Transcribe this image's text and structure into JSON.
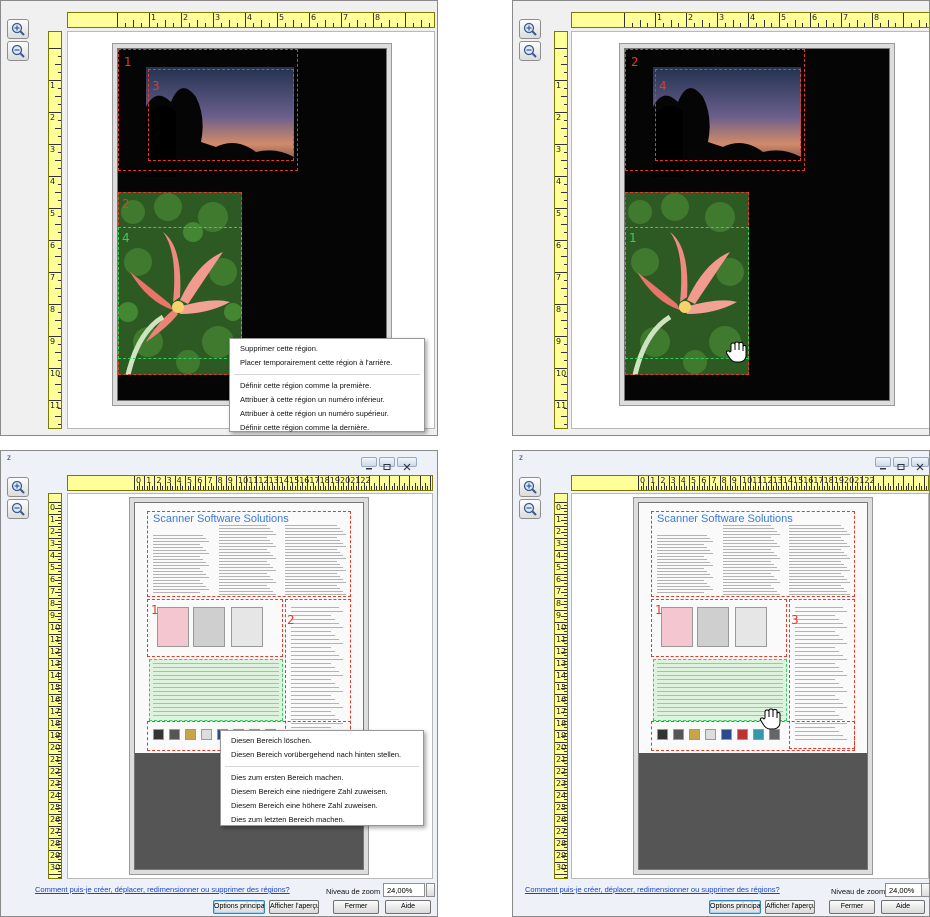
{
  "top_ruler_numbers": [
    "1",
    "2",
    "3",
    "4",
    "5",
    "6",
    "7",
    "8"
  ],
  "bottom_ruler_numbers": [
    "0",
    "1",
    "2",
    "3",
    "4",
    "5",
    "6",
    "7",
    "8",
    "9",
    "10",
    "11",
    "12",
    "13",
    "14",
    "15",
    "16",
    "17",
    "18",
    "19",
    "20",
    "21",
    "22"
  ],
  "top_vruler_numbers": [
    "1",
    "2",
    "3",
    "4",
    "5",
    "6",
    "7",
    "8",
    "9",
    "10",
    "11"
  ],
  "bottom_vruler_numbers": [
    "0",
    "1",
    "2",
    "3",
    "4",
    "5",
    "6",
    "7",
    "8",
    "9",
    "10",
    "11",
    "12",
    "13",
    "14",
    "15",
    "16",
    "17",
    "18",
    "19",
    "20",
    "21",
    "22",
    "23",
    "24",
    "25",
    "26",
    "27",
    "28",
    "29",
    "30"
  ],
  "panel_tl": {
    "region_labels": {
      "r1": "1",
      "r3": "3",
      "r2": "2",
      "r4": "4"
    },
    "context_menu": [
      "Supprimer cette région.",
      "Placer temporairement cette région à l'arrière.",
      "Définir cette région comme la première.",
      "Attribuer à cette région un numéro inférieur.",
      "Attribuer à cette région un numéro supérieur.",
      "Définir cette région comme la dernière."
    ]
  },
  "panel_tr": {
    "region_labels": {
      "r2": "2",
      "r4": "4",
      "r1": "1"
    }
  },
  "panel_bl": {
    "window_title": "z",
    "doc_title": "Scanner Software Solutions",
    "region_labels": {
      "r1": "1",
      "r2": "2"
    },
    "context_menu": [
      "Diesen Bereich löschen.",
      "Diesen Bereich vorübergehend nach hinten stellen.",
      "Dies zum ersten Bereich machen.",
      "Diesem Bereich eine niedrigere Zahl zuweisen.",
      "Diesem Bereich eine höhere Zahl zuweisen.",
      "Dies zum letzten Bereich machen."
    ],
    "help_link": "Comment puis-je créer, déplacer, redimensionner ou supprimer des régions?",
    "zoom_label": "Niveau de zoom :",
    "zoom_value": "24,00%",
    "buttons": [
      "Options principal",
      "Afficher l'aperçu",
      "Fermer",
      "Aide"
    ]
  },
  "panel_br": {
    "window_title": "z",
    "doc_title": "Scanner Software Solutions",
    "region_labels": {
      "r1": "1",
      "r3": "3"
    },
    "help_link": "Comment puis-je créer, déplacer, redimensionner ou supprimer des régions?",
    "zoom_label": "Niveau de zoom :",
    "zoom_value": "24,00%",
    "buttons": [
      "Options principal",
      "Afficher l'aperçu",
      "Fermer",
      "Aide"
    ]
  },
  "colors": {
    "ruler": "#ffff99",
    "region_red": "#e23b2a",
    "region_green": "#2fd05a",
    "link": "#1a44c8"
  },
  "icons": [
    "zoom-in-icon",
    "zoom-out-icon",
    "hand-cursor-icon",
    "minimize-icon",
    "maximize-icon",
    "close-icon"
  ]
}
